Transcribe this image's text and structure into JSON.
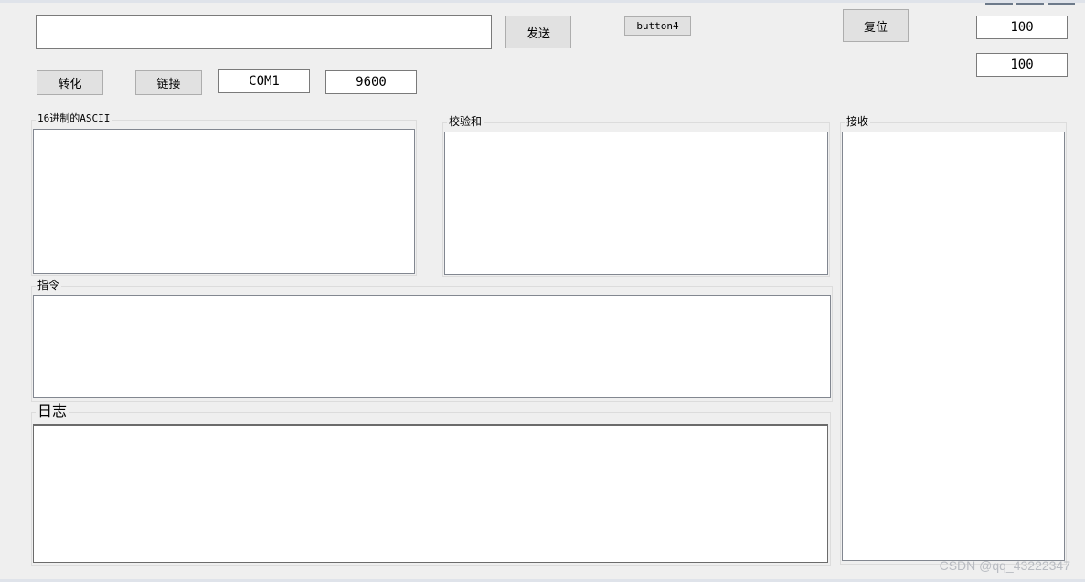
{
  "toolbar": {
    "send_label": "发送",
    "button4_label": "button4",
    "reset_label": "复位",
    "convert_label": "转化",
    "connect_label": "链接"
  },
  "inputs": {
    "send_text": "",
    "port": "COM1",
    "baud": "9600",
    "value1": "100",
    "value2": "100"
  },
  "groups": {
    "hex_ascii": "16进制的ASCII",
    "checksum": "校验和",
    "receive": "接收",
    "command": "指令",
    "log": "日志"
  },
  "watermark": "CSDN @qq_43222347"
}
